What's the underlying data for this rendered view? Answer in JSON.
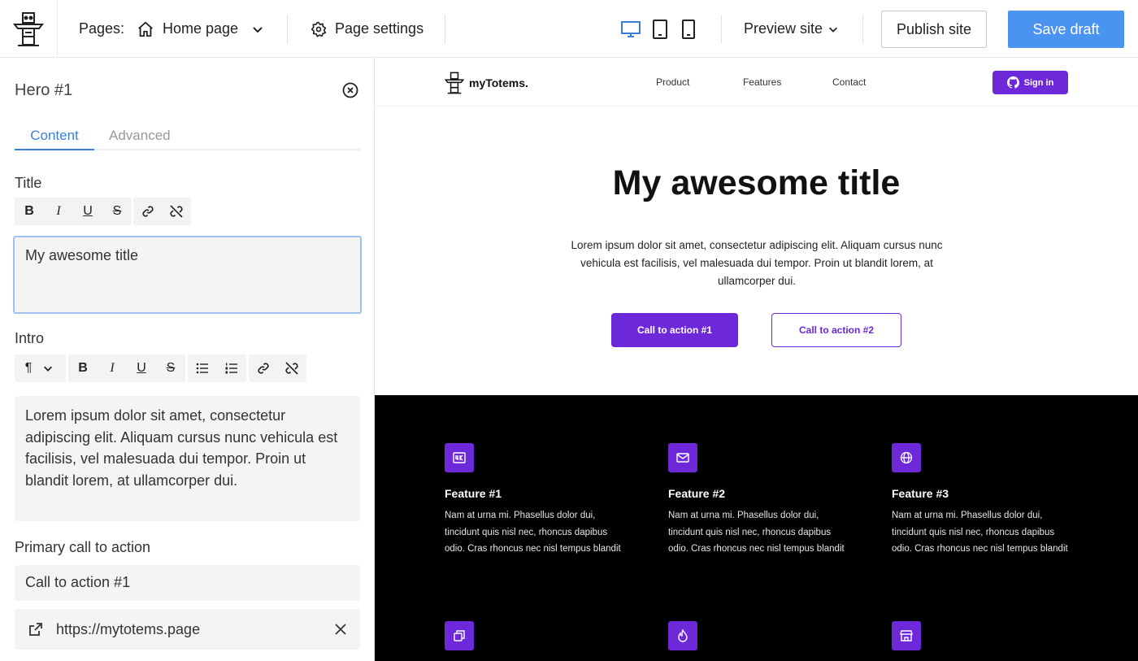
{
  "topbar": {
    "pages_label": "Pages:",
    "current_page": "Home page",
    "page_settings": "Page settings",
    "preview_site": "Preview site",
    "publish_site": "Publish site",
    "save_draft": "Save draft",
    "accent_color": "#4b93f1",
    "active_device_color": "#3b7fd6"
  },
  "panel": {
    "title": "Hero #1",
    "tabs": [
      {
        "label": "Content",
        "active": true
      },
      {
        "label": "Advanced",
        "active": false
      }
    ],
    "title_field": {
      "label": "Title",
      "value": "My awesome title"
    },
    "intro_field": {
      "label": "Intro",
      "value": "Lorem ipsum dolor sit amet, consectetur adipiscing elit. Aliquam cursus nunc vehicula est facilisis, vel malesuada dui tempor. Proin ut blandit lorem, at ullamcorper dui."
    },
    "primary_cta": {
      "label": "Primary call to action",
      "text_value": "Call to action #1",
      "url_value": "https://mytotems.page"
    }
  },
  "preview": {
    "brand": "myTotems.",
    "nav_links": [
      "Product",
      "Features",
      "Contact"
    ],
    "sign_in": "Sign in",
    "hero_title": "My awesome title",
    "hero_intro": "Lorem ipsum dolor sit amet, consectetur adipiscing elit. Aliquam cursus nunc vehicula est facilisis, vel malesuada dui tempor. Proin ut blandit lorem, at ullamcorper dui.",
    "cta_primary": "Call to action #1",
    "cta_secondary": "Call to action #2",
    "brand_color": "#6d28d9",
    "features": [
      {
        "title": "Feature #1",
        "text": "Nam at urna mi. Phasellus dolor dui, tincidunt quis nisl nec, rhoncus dapibus odio. Cras rhoncus nec nisl tempus blandit",
        "icon": "4k-icon"
      },
      {
        "title": "Feature #2",
        "text": "Nam at urna mi. Phasellus dolor dui, tincidunt quis nisl nec, rhoncus dapibus odio. Cras rhoncus nec nisl tempus blandit",
        "icon": "mail-icon"
      },
      {
        "title": "Feature #3",
        "text": "Nam at urna mi. Phasellus dolor dui, tincidunt quis nisl nec, rhoncus dapibus odio. Cras rhoncus nec nisl tempus blandit",
        "icon": "globe-icon"
      }
    ],
    "feature_icons_row2": [
      "copy-icon",
      "flame-icon",
      "store-icon"
    ]
  }
}
